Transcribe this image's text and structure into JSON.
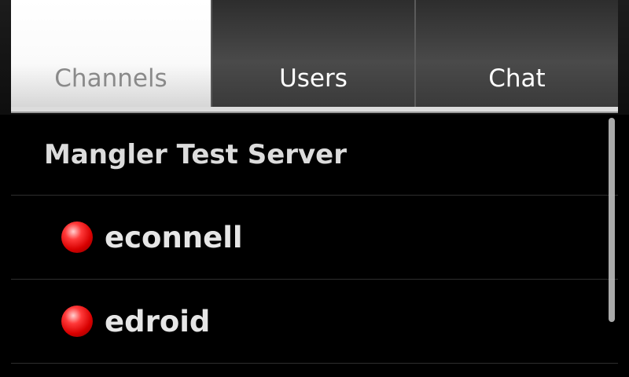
{
  "tabs": [
    {
      "label": "Channels",
      "active": true
    },
    {
      "label": "Users",
      "active": false
    },
    {
      "label": "Chat",
      "active": false
    }
  ],
  "server": {
    "name": "Mangler Test Server"
  },
  "users": [
    {
      "name": "econnell",
      "status_color": "#e00000",
      "status_icon": "red-dot-icon"
    },
    {
      "name": "edroid",
      "status_color": "#e00000",
      "status_icon": "red-dot-icon"
    }
  ]
}
